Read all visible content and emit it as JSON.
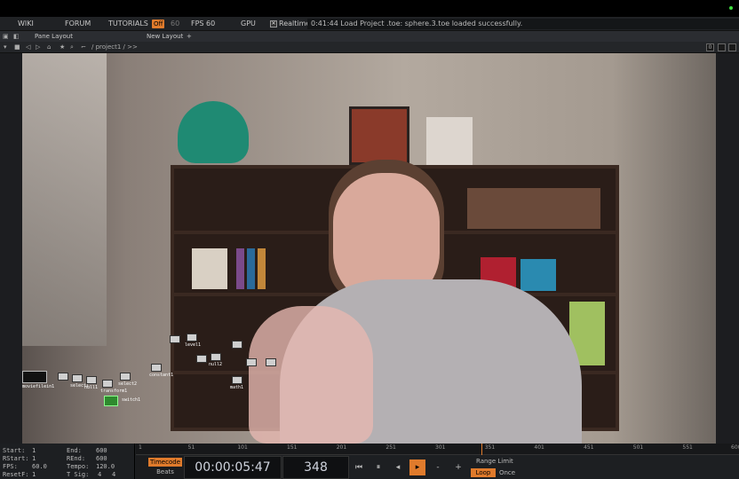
{
  "menubar": {
    "wiki": "WIKI",
    "forum": "FORUM",
    "tutorials": "TUTORIALS",
    "perform_badge": "Off",
    "perform_num": "60",
    "fps_label": "FPS",
    "fps_value": "60",
    "gpu": "GPU",
    "realtime": "Realtime",
    "status": "0:41:44 Load Project .toe: sphere.3.toe loaded successfully."
  },
  "panebar": {
    "pane_layout": "Pane Layout",
    "new_layout": "New Layout",
    "add": "+"
  },
  "pathbar": {
    "path": "/ project1 / >>",
    "right_box": "0"
  },
  "nodes": {
    "labels": [
      "moviefilein1",
      "select1",
      "null1",
      "transform1",
      "select2",
      "switch1",
      "constant1",
      "level1",
      "null2",
      "math1"
    ]
  },
  "stats": {
    "start_label": "Start:",
    "start_value": "1",
    "rstart_label": "RStart:",
    "rstart_value": "1",
    "fps_label": "FPS:",
    "fps_value": "60.0",
    "resetf_label": "ResetF:",
    "resetf_value": "1",
    "end_label": "End:",
    "end_value": "600",
    "rend_label": "REnd:",
    "rend_value": "600",
    "tempo_label": "Tempo:",
    "tempo_value": "120.0",
    "tsig_label": "T Sig:",
    "tsig_value1": "4",
    "tsig_value2": "4"
  },
  "ruler": {
    "ticks": [
      "1",
      "51",
      "101",
      "151",
      "201",
      "251",
      "301",
      "351",
      "401",
      "451",
      "501",
      "551",
      "600"
    ]
  },
  "transport": {
    "timecode": "Timecode",
    "beats": "Beats",
    "time": "00:00:05:47",
    "frame": "348",
    "range_limit": "Range Limit",
    "loop": "Loop",
    "once": "Once",
    "playhead_frame": 348,
    "timeline_start": 1,
    "timeline_end": 600
  },
  "colors": {
    "accent": "#e07b2c",
    "panel": "#202225"
  }
}
